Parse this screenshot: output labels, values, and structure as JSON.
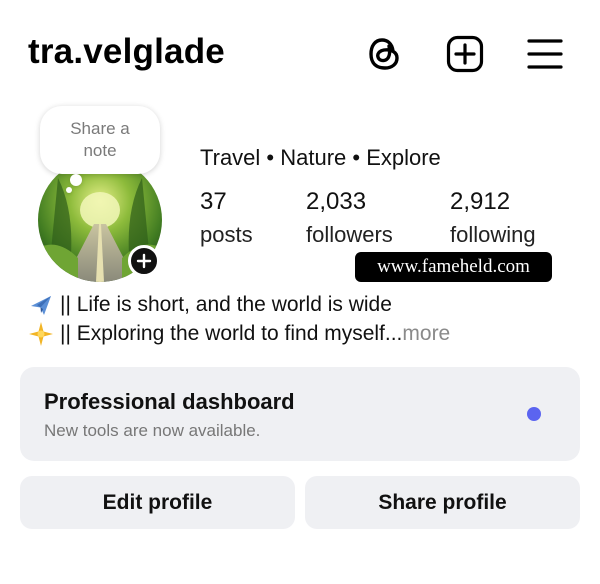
{
  "header": {
    "username": "tra.velglade",
    "icons": [
      "threads-icon",
      "create-post-icon",
      "menu-icon"
    ]
  },
  "note": {
    "text": "Share a note"
  },
  "profile": {
    "category": "Travel • Nature • Explore",
    "stats": [
      {
        "value": "37",
        "label": "posts"
      },
      {
        "value": "2,033",
        "label": "followers"
      },
      {
        "value": "2,912",
        "label": "following"
      }
    ]
  },
  "watermark": "www.fameheld.com",
  "bio": {
    "line1_icon": "airplane-emoji",
    "line1": "|| Life is short, and the world is wide",
    "line2_icon": "sparkle-emoji",
    "line2": "|| Exploring the world to find myself...",
    "more": " more"
  },
  "dashboard": {
    "title": "Professional dashboard",
    "subtitle": "New tools are now available.",
    "dot_color": "#5b64f0"
  },
  "buttons": {
    "edit": "Edit profile",
    "share": "Share profile"
  }
}
